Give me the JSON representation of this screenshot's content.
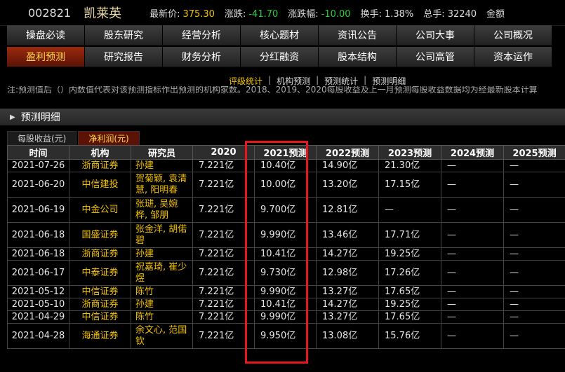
{
  "header": {
    "code": "002821",
    "name": "凯莱英",
    "quotes": [
      {
        "label": "最新价:",
        "value": "375.30",
        "color": "yellow"
      },
      {
        "label": "涨跌:",
        "value": "-41.70",
        "color": "green"
      },
      {
        "label": "涨跌幅:",
        "value": "-10.00",
        "color": "green"
      },
      {
        "label": "换手:",
        "value": "1.38%",
        "color": "white"
      },
      {
        "label": "总手:",
        "value": "32240",
        "color": "white"
      },
      {
        "label": "金额",
        "value": "",
        "color": "white"
      }
    ]
  },
  "nav": {
    "row1": [
      "操盘必读",
      "股东研究",
      "经营分析",
      "核心题材",
      "资讯公告",
      "公司大事",
      "公司概况"
    ],
    "row2": [
      "盈利预测",
      "研究报告",
      "财务分析",
      "分红融资",
      "股本结构",
      "公司高管",
      "资本运作"
    ],
    "active": "盈利预测"
  },
  "subnav": {
    "items": [
      "评级统计",
      "机构预测",
      "预测统计",
      "预测明细"
    ],
    "active": "评级统计"
  },
  "note": "注:预测值后（）内数值代表对该预测指标作出预测的机构家数。2018、2019、2020每股收益及上一月预测每股收益数据均为经最新股本计算",
  "section": {
    "title": "预测明细"
  },
  "tabs": {
    "items": [
      "每股收益(元)",
      "净利润(元)"
    ],
    "active": "净利润(元)"
  },
  "table": {
    "headers": [
      "时间",
      "机构",
      "研究员",
      "2020",
      "2021预测",
      "2022预测",
      "2023预测",
      "2024预测",
      "2025预测"
    ],
    "rows": [
      [
        "2021-07-26",
        "浙商证券",
        "孙建",
        "7.221亿",
        "10.40亿",
        "14.90亿",
        "21.30亿",
        "—",
        "—"
      ],
      [
        "2021-06-20",
        "中信建投",
        "贺菊颖, 袁清慧, 阳明春",
        "7.221亿",
        "10.00亿",
        "13.20亿",
        "17.15亿",
        "—",
        "—"
      ],
      [
        "2021-06-19",
        "中金公司",
        "张琎, 吴婉桦, 邹朋",
        "7.221亿",
        "9.700亿",
        "12.81亿",
        "—",
        "—",
        "—"
      ],
      [
        "2021-06-18",
        "国盛证券",
        "张金洋, 胡偌碧",
        "7.221亿",
        "9.990亿",
        "13.46亿",
        "17.71亿",
        "—",
        "—"
      ],
      [
        "2021-06-18",
        "浙商证券",
        "孙建",
        "7.221亿",
        "10.41亿",
        "14.27亿",
        "19.25亿",
        "—",
        "—"
      ],
      [
        "2021-06-17",
        "中泰证券",
        "祝嘉琦, 崔少煜",
        "7.221亿",
        "9.730亿",
        "12.98亿",
        "17.26亿",
        "—",
        "—"
      ],
      [
        "2021-05-12",
        "中信证券",
        "陈竹",
        "7.221亿",
        "9.990亿",
        "13.27亿",
        "17.65亿",
        "—",
        "—"
      ],
      [
        "2021-05-10",
        "浙商证券",
        "孙建",
        "7.221亿",
        "10.41亿",
        "14.27亿",
        "19.25亿",
        "—",
        "—"
      ],
      [
        "2021-04-29",
        "中信证券",
        "陈竹",
        "7.221亿",
        "9.990亿",
        "13.27亿",
        "17.65亿",
        "—",
        "—"
      ],
      [
        "2021-04-28",
        "海通证券",
        "余文心, 范国钦",
        "7.221亿",
        "9.950亿",
        "13.08亿",
        "15.76亿",
        "—",
        "—"
      ]
    ]
  }
}
